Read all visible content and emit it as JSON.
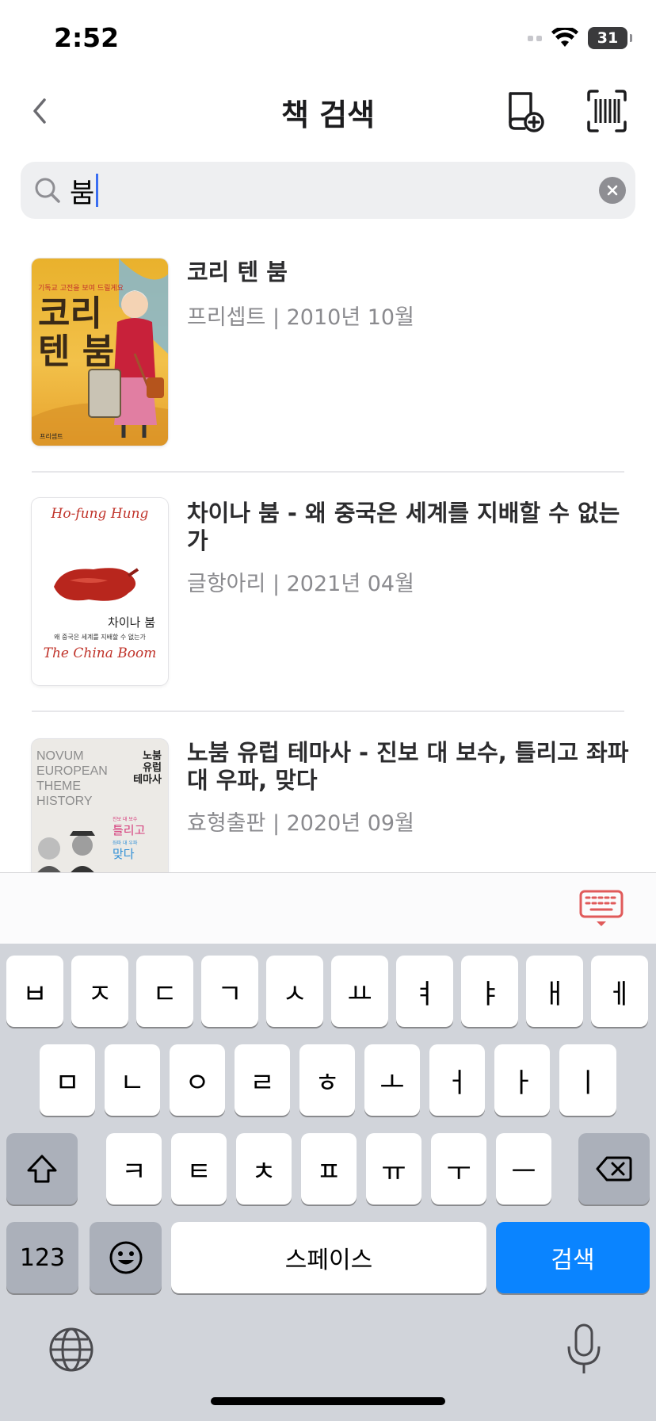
{
  "status_bar": {
    "time": "2:52",
    "battery": "31"
  },
  "nav": {
    "title": "책 검색"
  },
  "search": {
    "query": "붐"
  },
  "results": [
    {
      "title": "코리 텐 붐",
      "meta": "프리셉트 | 2010년 10월",
      "cover": {
        "header": "기독교 고전을 보여 드릴게요",
        "title_lines": [
          "코리",
          "텐 붐"
        ],
        "footer": "프리셉트"
      }
    },
    {
      "title": "차이나 붐 - 왜 중국은 세계를 지배할 수 없는가",
      "meta": "글항아리 | 2021년 04월",
      "cover": {
        "author": "Ho-fung Hung",
        "ko_title": "차이나 붐",
        "subtitle": "왜 중국은 세계를 지배할 수 없는가",
        "en_title": "The China Boom"
      }
    },
    {
      "title": "노붐 유럽 테마사 - 진보 대 보수, 틀리고 좌파 대 우파, 맞다",
      "meta": "효형출판 | 2020년 09월",
      "cover": {
        "en_lines": [
          "NOVUM",
          "EUROPEAN",
          "THEME",
          "HISTORY"
        ],
        "ko_lines": [
          "노붐",
          "유럽",
          "테마사"
        ],
        "small1": "진보 대 보수",
        "big1": "틀리고",
        "small2": "좌파 대 우파",
        "big2": "맞다"
      }
    }
  ],
  "keyboard": {
    "row1": [
      "ㅂ",
      "ㅈ",
      "ㄷ",
      "ㄱ",
      "ㅅ",
      "ㅛ",
      "ㅕ",
      "ㅑ",
      "ㅐ",
      "ㅔ"
    ],
    "row2": [
      "ㅁ",
      "ㄴ",
      "ㅇ",
      "ㄹ",
      "ㅎ",
      "ㅗ",
      "ㅓ",
      "ㅏ",
      "ㅣ"
    ],
    "row3": [
      "ㅋ",
      "ㅌ",
      "ㅊ",
      "ㅍ",
      "ㅠ",
      "ㅜ",
      "ㅡ"
    ],
    "numbers_label": "123",
    "space_label": "스페이스",
    "search_label": "검색"
  },
  "icons": {
    "back": "chevron-left-icon",
    "add_book": "add-book-icon",
    "barcode": "barcode-scan-icon",
    "search": "search-icon",
    "clear": "clear-icon",
    "keyboard_hide": "keyboard-hide-icon",
    "shift": "shift-icon",
    "backspace": "backspace-icon",
    "emoji": "emoji-icon",
    "globe": "globe-icon",
    "mic": "microphone-icon"
  },
  "colors": {
    "accent": "#0a84ff",
    "caret": "#3a6ef2",
    "keyboard_hide_icon": "#e05a5a"
  }
}
